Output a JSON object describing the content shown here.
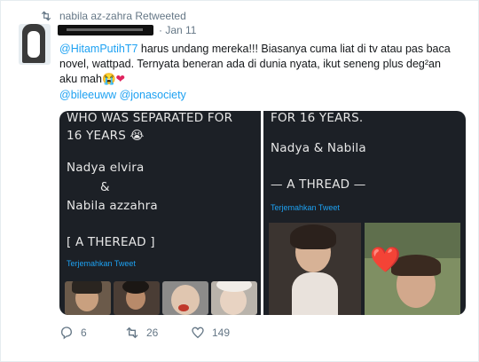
{
  "retweet_header": {
    "text": "nabila az-zahra Retweeted"
  },
  "tweet": {
    "date": "· Jan 11",
    "body": {
      "mention": "@HitamPutihT7",
      "text": " harus undang mereka!!! Biasanya cuma liat di tv atau pas baca novel, wattpad. Ternyata beneran ada di dunia nyata, ikut seneng plus deg²an aku mah😭",
      "heart": "❤"
    },
    "mentions_line": "@bileeuww @jonasociety"
  },
  "media": {
    "left": {
      "line1": "WHO WAS SEPARATED FOR",
      "line2": "16 YEARS 😭",
      "name1": "Nadya elvira",
      "amp": "&",
      "name2": "Nabila azzahra",
      "thread": "[ A THEREAD ]",
      "translate": "Terjemahkan Tweet"
    },
    "right": {
      "line1": "FOR 16 YEARS.",
      "names": "Nadya & Nabila",
      "thread": "— A THREAD —",
      "translate": "Terjemahkan Tweet",
      "heart": "❤️"
    }
  },
  "actions": {
    "replies": "6",
    "retweets": "26",
    "likes": "149"
  },
  "colors": {
    "link": "#1da1f2",
    "heart": "#e0245e",
    "muted": "#657786",
    "panel": "#1c2026"
  }
}
